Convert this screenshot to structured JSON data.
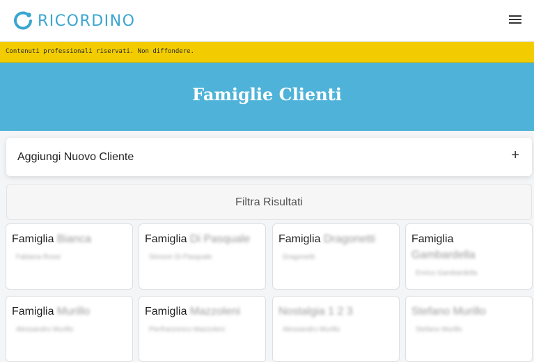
{
  "brand": {
    "name": "RICORDINO",
    "accent": "#3aa6cf"
  },
  "header": {
    "menu_icon": "hamburger-menu-icon"
  },
  "banner": {
    "text": "Contenuti professionali riservati. Non diffondere.",
    "color": "#f2cc00"
  },
  "hero": {
    "title": "Famiglie Clienti",
    "color": "#4fb3d9"
  },
  "add_client": {
    "label": "Aggiungi Nuovo Cliente",
    "icon": "+"
  },
  "filter": {
    "label": "Filtra Risultati"
  },
  "families": [
    {
      "prefix": "Famiglia",
      "name": "Bianca",
      "member": "Fabiana Rossi"
    },
    {
      "prefix": "Famiglia",
      "name": "Di Pasquale",
      "member": "Simone Di Pasquale"
    },
    {
      "prefix": "Famiglia",
      "name": "Dragonetti",
      "member": "Dragonetti"
    },
    {
      "prefix": "Famiglia",
      "name": "Gambardella",
      "member": "Enrico Gambardella"
    },
    {
      "prefix": "Famiglia",
      "name": "Murillo",
      "member": "Alessandro Murillo"
    },
    {
      "prefix": "Famiglia",
      "name": "Mazzoleni",
      "member": "Pierfrancesco Mazzoleni"
    },
    {
      "prefix": "",
      "name": "Nostalgia 1 2 3",
      "member": "Alessandro Murillo"
    },
    {
      "prefix": "",
      "name": "Stefano Murillo",
      "member": "Stefano Murillo"
    }
  ]
}
